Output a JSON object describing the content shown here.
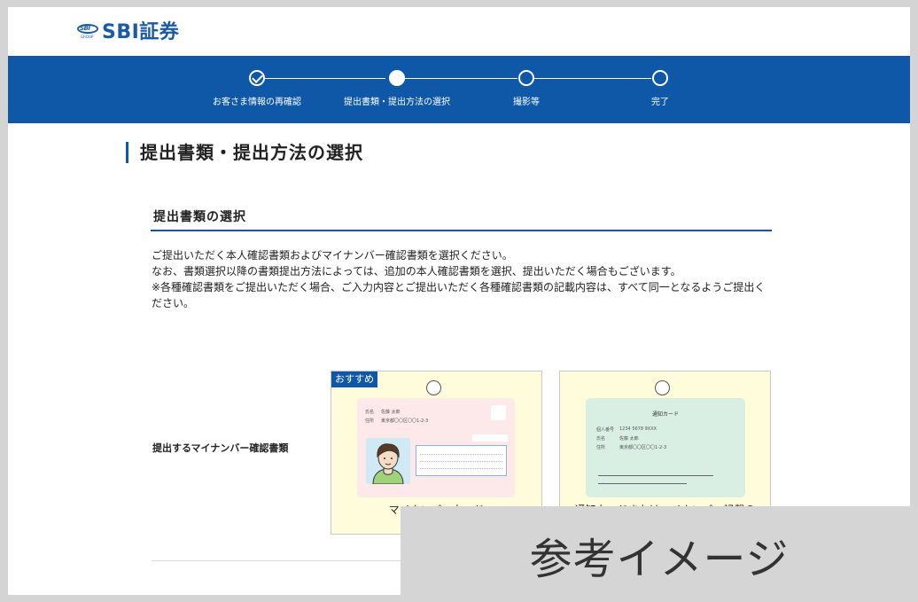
{
  "header": {
    "logo_text": "SBI証券",
    "logo_mark": "SBI",
    "logo_mark_sub": "GROUP"
  },
  "stepper": {
    "steps": [
      {
        "label": "お客さま情報の再確認",
        "state": "done"
      },
      {
        "label": "提出書類・提出方法の選択",
        "state": "current"
      },
      {
        "label": "撮影等",
        "state": "todo"
      },
      {
        "label": "完了",
        "state": "todo"
      }
    ]
  },
  "page": {
    "title": "提出書類・提出方法の選択"
  },
  "section": {
    "title": "提出書類の選択",
    "description": [
      "ご提出いただく本人確認書類およびマイナンバー確認書類を選択ください。",
      "なお、書類選択以降の書類提出方法によっては、追加の本人確認書類を選択、提出いただく場合もございます。",
      "※各種確認書類をご提出いただく場合、ご入力内容とご提出いただく各種確認書類の記載内容は、すべて同一となるようご提出ください。"
    ]
  },
  "selection": {
    "label": "提出するマイナンバー確認書類",
    "options": [
      {
        "badge": "おすすめ",
        "caption": "マイナンバーカード",
        "card": {
          "name_label": "氏名",
          "name": "佐藤 太郎",
          "address_label": "住所",
          "address": "東京都〇〇区〇〇1-2-3"
        }
      },
      {
        "caption": "通知カードまたはマイナンバー記載の",
        "card": {
          "title": "通知カード",
          "number_label": "個人番号",
          "number": "1234 5678 9XXX",
          "name_label": "氏名",
          "name": "佐藤 太郎",
          "address_label": "住所",
          "address": "東京都〇〇区〇〇1-2-3"
        }
      }
    ]
  },
  "overlay": {
    "text": "参考イメージ"
  },
  "colors": {
    "brand_blue": "#0f58a8",
    "card_bg": "#fffcdc",
    "mycard_pink": "#fde9ea",
    "notice_green": "#d9efe3"
  }
}
